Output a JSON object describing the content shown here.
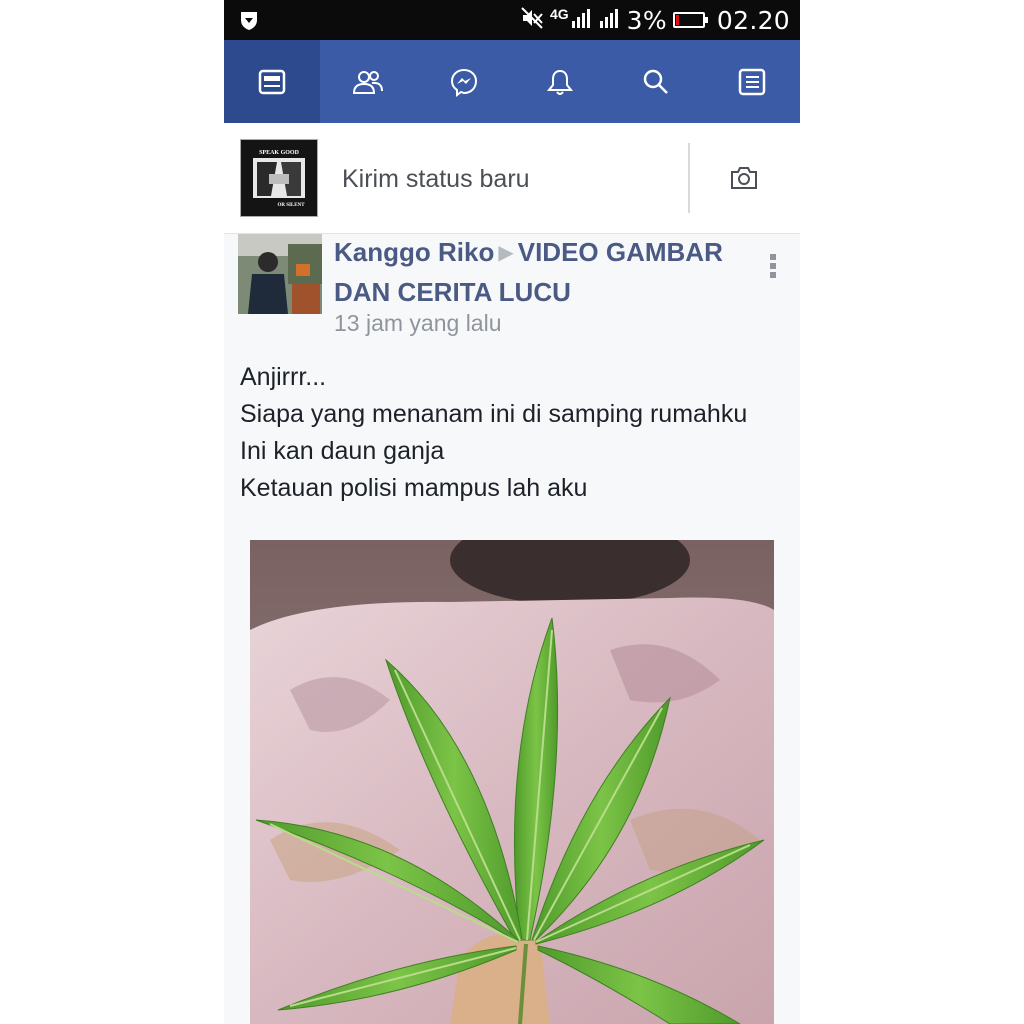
{
  "status_bar": {
    "network": "4G",
    "battery": "3%",
    "time": "02.20",
    "icons": [
      "shield-icon",
      "mute-icon",
      "signal-icon",
      "signal-icon",
      "battery-icon"
    ]
  },
  "nav": {
    "items": [
      {
        "name": "news-feed",
        "icon": "newsfeed-icon",
        "active": true
      },
      {
        "name": "friends",
        "icon": "friends-icon"
      },
      {
        "name": "messenger",
        "icon": "messenger-icon"
      },
      {
        "name": "notifications",
        "icon": "bell-icon"
      },
      {
        "name": "search",
        "icon": "search-icon"
      },
      {
        "name": "menu",
        "icon": "menu-icon"
      }
    ],
    "colors": {
      "bar": "#3b5ba7",
      "active": "#2e4a8f"
    }
  },
  "composer": {
    "placeholder": "Kirim status baru",
    "avatar_text_top": "SPEAK GOOD",
    "avatar_text_bottom": "OR SILENT"
  },
  "post": {
    "author": "Kanggo Riko",
    "group": "VIDEO GAMBAR DAN CERITA LUCU",
    "time": "13 jam yang lalu",
    "lines": [
      "Anjirrr...",
      "Siapa yang menanam ini di samping rumahku",
      "Ini kan daun ganja",
      "Ketauan polisi mampus lah aku"
    ],
    "link_color": "#4a5a84"
  }
}
